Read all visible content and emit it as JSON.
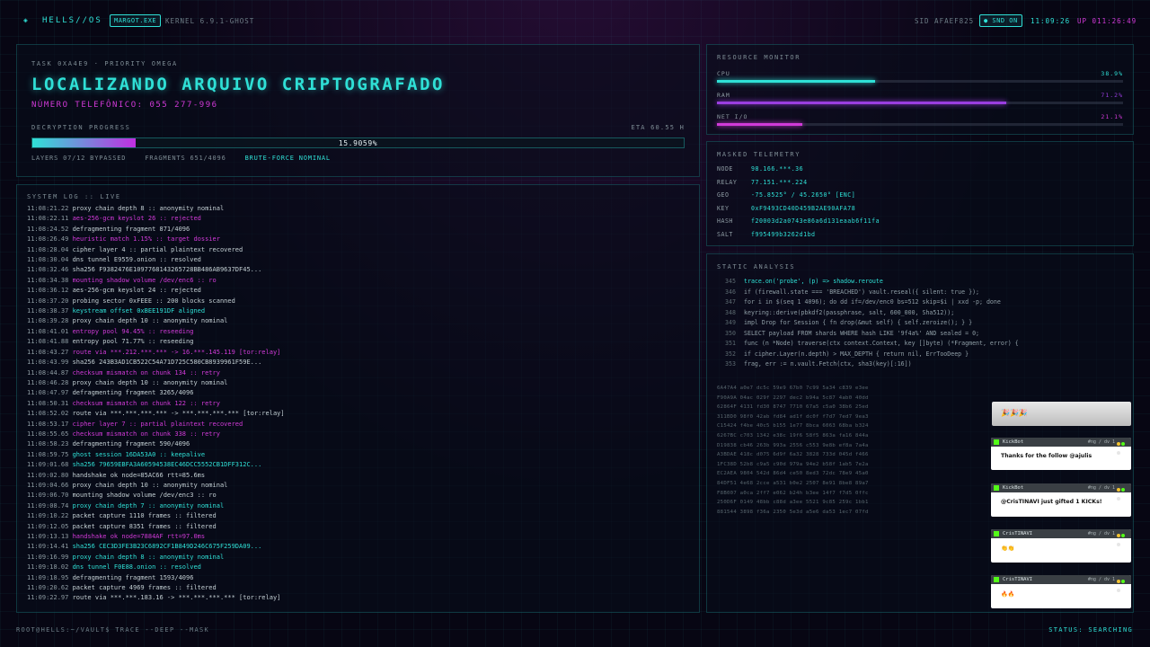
{
  "topbar": {
    "logo_glyph": "◈",
    "brand": "HELLS//OS",
    "process_badge": "MARGOT.EXE",
    "kernel": "KERNEL 6.9.1-GHOST",
    "sid": "SID AFAEF825",
    "snd_badge": "● SND ON",
    "clock": "11:09:26",
    "uptime": "UP 011:26:49"
  },
  "task": {
    "subtitle": "TASK 0XA4E9 · PRIORITY OMEGA",
    "title": "LOCALIZANDO ARQUIVO CRIPTOGRAFADO",
    "phone": "NÚMERO TELEFÔNICO: 055 277-996",
    "progress_label": "DECRYPTION PROGRESS",
    "eta": "ETA 60.55 H",
    "progress_percent": 15.9059,
    "progress_text": "15.9059%",
    "layers": "LAYERS 07/12 BYPASSED",
    "fragments": "FRAGMENTS 651/4096",
    "status": "BRUTE-FORCE NOMINAL"
  },
  "log": {
    "title": "SYSTEM LOG :: LIVE",
    "lines": [
      {
        "ts": "11:08:21.22",
        "msg": "proxy chain depth 8 :: anonymity nominal",
        "tone": "white"
      },
      {
        "ts": "11:08:22.11",
        "msg": "aes-256-gcm keyslot 26 :: rejected",
        "tone": "magenta"
      },
      {
        "ts": "11:08:24.52",
        "msg": "defragmenting fragment 871/4096",
        "tone": "white"
      },
      {
        "ts": "11:08:26.49",
        "msg": "heuristic match 1.15% :: target dossier",
        "tone": "magenta"
      },
      {
        "ts": "11:08:28.04",
        "msg": "cipher layer 4 :: partial plaintext recovered",
        "tone": "white"
      },
      {
        "ts": "11:08:30.04",
        "msg": "dns tunnel E9559.onion :: resolved",
        "tone": "white"
      },
      {
        "ts": "11:08:32.46",
        "msg": "sha256 F9382476E1097768143265728BB486AB9637DF45...",
        "tone": "white"
      },
      {
        "ts": "11:08:34.38",
        "msg": "mounting shadow volume /dev/enc6 :: ro",
        "tone": "magenta"
      },
      {
        "ts": "11:08:36.12",
        "msg": "aes-256-gcm keyslot 24 :: rejected",
        "tone": "white"
      },
      {
        "ts": "11:08:37.20",
        "msg": "probing sector 0xFEEE :: 200 blocks scanned",
        "tone": "white"
      },
      {
        "ts": "11:08:38.37",
        "msg": "keystream offset 0xBEE191DF aligned",
        "tone": "cyan"
      },
      {
        "ts": "11:08:39.28",
        "msg": "proxy chain depth 10 :: anonymity nominal",
        "tone": "white"
      },
      {
        "ts": "11:08:41.01",
        "msg": "entropy pool 94.45% :: reseeding",
        "tone": "magenta"
      },
      {
        "ts": "11:08:41.88",
        "msg": "entropy pool 71.77% :: reseeding",
        "tone": "white"
      },
      {
        "ts": "11:08:43.27",
        "msg": "route via ***.212.***.*** -> 16.***.145.119 [tor:relay]",
        "tone": "magenta"
      },
      {
        "ts": "11:08:43.99",
        "msg": "sha256 243B3AD1CB522C54A71D725C580CB8939961F59E...",
        "tone": "white"
      },
      {
        "ts": "11:08:44.87",
        "msg": "checksum mismatch on chunk 134 :: retry",
        "tone": "magenta"
      },
      {
        "ts": "11:08:46.28",
        "msg": "proxy chain depth 10 :: anonymity nominal",
        "tone": "white"
      },
      {
        "ts": "11:08:47.97",
        "msg": "defragmenting fragment 3265/4096",
        "tone": "white"
      },
      {
        "ts": "11:08:50.31",
        "msg": "checksum mismatch on chunk 122 :: retry",
        "tone": "magenta"
      },
      {
        "ts": "11:08:52.02",
        "msg": "route via ***.***.***.*** -> ***.***.***.*** [tor:relay]",
        "tone": "white"
      },
      {
        "ts": "11:08:53.17",
        "msg": "cipher layer 7 :: partial plaintext recovered",
        "tone": "magenta"
      },
      {
        "ts": "11:08:55.65",
        "msg": "checksum mismatch on chunk 338 :: retry",
        "tone": "magenta"
      },
      {
        "ts": "11:08:58.23",
        "msg": "defragmenting fragment 590/4096",
        "tone": "white"
      },
      {
        "ts": "11:08:59.75",
        "msg": "ghost session 16DA53A0 :: keepalive",
        "tone": "cyan"
      },
      {
        "ts": "11:09:01.68",
        "msg": "sha256 79659EBFA3A60594538EC46DCC5552CB1DFF312C...",
        "tone": "cyan"
      },
      {
        "ts": "11:09:02.80",
        "msg": "handshake ok node=85AC66 rtt=85.6ms",
        "tone": "white"
      },
      {
        "ts": "11:09:04.66",
        "msg": "proxy chain depth 10 :: anonymity nominal",
        "tone": "white"
      },
      {
        "ts": "11:09:06.70",
        "msg": "mounting shadow volume /dev/enc3 :: ro",
        "tone": "white"
      },
      {
        "ts": "11:09:08.74",
        "msg": "proxy chain depth 7 :: anonymity nominal",
        "tone": "cyan"
      },
      {
        "ts": "11:09:10.22",
        "msg": "packet capture 1110 frames :: filtered",
        "tone": "white"
      },
      {
        "ts": "11:09:12.05",
        "msg": "packet capture 8351 frames :: filtered",
        "tone": "white"
      },
      {
        "ts": "11:09:13.13",
        "msg": "handshake ok node=7884AF rtt=97.0ms",
        "tone": "magenta"
      },
      {
        "ts": "11:09:14.41",
        "msg": "sha256 CEC3D3FE3B23C6892CF1B849D246C675F259DA09...",
        "tone": "cyan"
      },
      {
        "ts": "11:09:16.99",
        "msg": "proxy chain depth 8 :: anonymity nominal",
        "tone": "cyan"
      },
      {
        "ts": "11:09:18.02",
        "msg": "dns tunnel F0E88.onion :: resolved",
        "tone": "cyan"
      },
      {
        "ts": "11:09:18.95",
        "msg": "defragmenting fragment 1593/4096",
        "tone": "white"
      },
      {
        "ts": "11:09:20.62",
        "msg": "packet capture 4969 frames :: filtered",
        "tone": "white"
      },
      {
        "ts": "11:09:22.97",
        "msg": "route via ***.***.183.16 -> ***.***.***.*** [tor:relay]",
        "tone": "white"
      }
    ]
  },
  "resources": {
    "title": "RESOURCE MONITOR",
    "items": [
      {
        "name": "CPU",
        "value_text": "38.9%",
        "level": 0.389,
        "color": "#2fe0d6"
      },
      {
        "name": "RAM",
        "value_text": "71.2%",
        "level": 0.712,
        "color": "#9a3ee0"
      },
      {
        "name": "NET I/O",
        "value_text": "21.1%",
        "level": 0.211,
        "color": "#d13ad8"
      }
    ]
  },
  "telemetry": {
    "title": "MASKED TELEMETRY",
    "rows": [
      {
        "key": "NODE",
        "value": "98.166.***.36"
      },
      {
        "key": "RELAY",
        "value": "77.151.***.224"
      },
      {
        "key": "GEO",
        "value": "-75.8525° / 45.2650° [ENC]"
      },
      {
        "key": "KEY",
        "value": "0xF9493CD40D459B2AE90AFA78"
      },
      {
        "key": "HASH",
        "value": "f20003d2a0743e86a6d131eaab6f11fa"
      },
      {
        "key": "SALT",
        "value": "f995499b3262d1bd"
      }
    ]
  },
  "analysis": {
    "title": "STATIC ANALYSIS",
    "code": [
      {
        "ln": "345",
        "text": "trace.on('probe', (p) => shadow.reroute",
        "hl": true
      },
      {
        "ln": "346",
        "text": "if (firewall.state === 'BREACHED') vault.reseal({ silent: true });",
        "hl": false
      },
      {
        "ln": "347",
        "text": "for i in $(seq 1 4096); do dd if=/dev/enc0 bs=512 skip=$i | xxd -p; done",
        "hl": false
      },
      {
        "ln": "348",
        "text": "keyring::derive(pbkdf2(passphrase, salt, 600_000, Sha512));",
        "hl": false
      },
      {
        "ln": "349",
        "text": "impl Drop for Session { fn drop(&mut self) { self.zeroize(); } }",
        "hl": false
      },
      {
        "ln": "350",
        "text": "SELECT payload FROM shards WHERE hash LIKE '9f4a%' AND sealed = 0;",
        "hl": false
      },
      {
        "ln": "351",
        "text": "func (n *Node) traverse(ctx context.Context, key []byte) (*Fragment, error) {",
        "hl": false
      },
      {
        "ln": "352",
        "text": "if cipher.Layer(n.depth) > MAX_DEPTH { return nil, ErrTooDeep }",
        "hl": false
      },
      {
        "ln": "353",
        "text": "frag, err := n.vault.Fetch(ctx, sha3(key)[:16])",
        "hl": false
      }
    ],
    "hex": [
      "6A47A4 a0e7 dc5c 59e9 67b0 7c99 5a34 c839 e3ee",
      "F90A9A 04ac 029f 2297 dec2 b94a 5c87 4ab0 40dd",
      "62864F 4131 fd30 8747 7710 67a5 c5a0 38b6 25ed",
      "311BD0 98f0 42ab fd84 ad1f dc0f f7d7 7ed7 9ea3",
      "C15424 f4be 40c5 b155 1e77 8bca 6063 68ba b324",
      "6267BC c703 1342 e38c 19f6 58f5 863a fa16 844a",
      "D19838 cb46 263b 993a 2556 c553 9e8b ef8a 7a4a",
      "A3BDAE 418c d075 6d9f 6a32 3828 733d 045d f466",
      "1FC38D 52b8 c9a5 c90d 979a 94e2 b58f 1ab5 7e2a",
      "EC2AEA 9804 542d 86d4 ce50 8ed3 72dc 78e9 45a0",
      "84DF51 4e68 2cce a531 b0e2 2507 8e91 8be8 89a7",
      "F8B007 a0ca 2ff7 e062 b24h b3ee 14f7 f7d5 0ffc",
      "250D6F 0149 48bb c88d a3ee 5521 9c85 259c 1bb1",
      "881544 3898 f36a 2350 5e3d a5e6 da53 1ec7 07fd"
    ]
  },
  "chat": {
    "top_message": "🎉🎉🎉",
    "messages": [
      {
        "user": "KickBot",
        "text": "Thanks for the follow @ajulis"
      },
      {
        "user": "KickBot",
        "text": "@CrisTINAVI just gifted 1 KICKs!"
      },
      {
        "user": "CrisTINAVI",
        "text": "👏👏"
      },
      {
        "user": "CrisTINAVI",
        "text": "🔥🔥"
      }
    ],
    "meta": "#ng / dv 1"
  },
  "footer": {
    "prompt": "ROOT@HELLS:~/VAULT$ TRACE --DEEP --MASK",
    "status": "STATUS: SEARCHING"
  }
}
